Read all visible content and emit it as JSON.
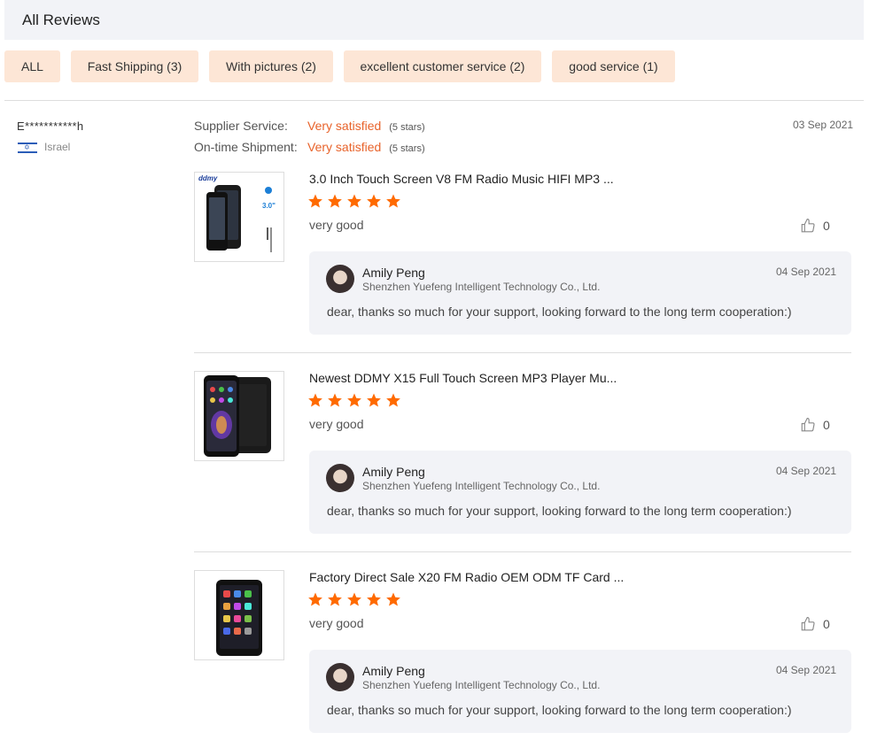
{
  "header": {
    "title": "All Reviews"
  },
  "filters": [
    {
      "label": "ALL"
    },
    {
      "label": "Fast Shipping (3)"
    },
    {
      "label": "With pictures (2)"
    },
    {
      "label": "excellent customer service (2)"
    },
    {
      "label": "good service (1)"
    }
  ],
  "review": {
    "reviewer_name": "E***********h",
    "country": "Israel",
    "date": "03 Sep 2021",
    "supplier_service": {
      "label": "Supplier Service:",
      "value": "Very satisfied",
      "stars": "(5 stars)"
    },
    "shipment": {
      "label": "On-time Shipment:",
      "value": "Very satisfied",
      "stars": "(5 stars)"
    }
  },
  "products": [
    {
      "title": "3.0 Inch Touch Screen V8 FM Radio Music HIFI MP3 ...",
      "rating": 5,
      "comment": "very good",
      "likes": "0",
      "reply": {
        "name": "Amily Peng",
        "company": "Shenzhen Yuefeng Intelligent Technology Co., Ltd.",
        "date": "04 Sep 2021",
        "text": "dear, thanks so much for your support, looking forward to the long term cooperation:)"
      }
    },
    {
      "title": "Newest DDMY X15 Full Touch Screen MP3 Player Mu...",
      "rating": 5,
      "comment": "very good",
      "likes": "0",
      "reply": {
        "name": "Amily Peng",
        "company": "Shenzhen Yuefeng Intelligent Technology Co., Ltd.",
        "date": "04 Sep 2021",
        "text": "dear, thanks so much for your support, looking forward to the long term cooperation:)"
      }
    },
    {
      "title": "Factory Direct Sale X20 FM Radio OEM ODM TF Card ...",
      "rating": 5,
      "comment": "very good",
      "likes": "0",
      "reply": {
        "name": "Amily Peng",
        "company": "Shenzhen Yuefeng Intelligent Technology Co., Ltd.",
        "date": "04 Sep 2021",
        "text": "dear, thanks so much for your support, looking forward to the long term cooperation:)"
      }
    }
  ],
  "thumb_labels": {
    "p1_brand": "ddmy",
    "p1_size": "3.0\""
  },
  "colors": {
    "accent": "#e8632b",
    "chip_bg": "#fde6d6",
    "panel_bg": "#f2f3f7"
  }
}
